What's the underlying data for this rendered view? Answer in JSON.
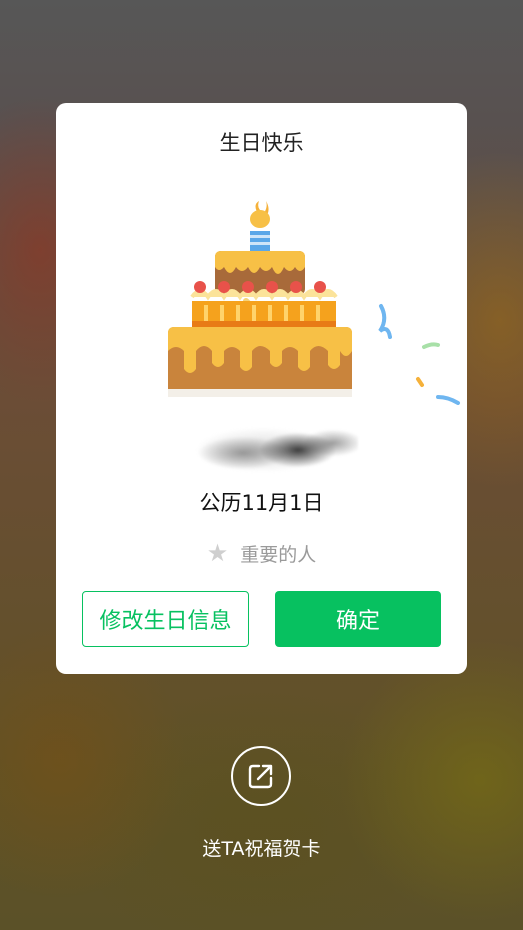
{
  "dialog": {
    "title": "生日快乐",
    "date_label": "公历11月1日",
    "important_label": "重要的人",
    "edit_button": "修改生日信息",
    "confirm_button": "确定"
  },
  "share": {
    "label": "送TA祝福贺卡"
  },
  "colors": {
    "accent": "#07c160",
    "card": "#ffffff"
  },
  "icons": {
    "cake": "birthday-cake-icon",
    "star": "star-icon",
    "share": "share-arrow-icon"
  }
}
